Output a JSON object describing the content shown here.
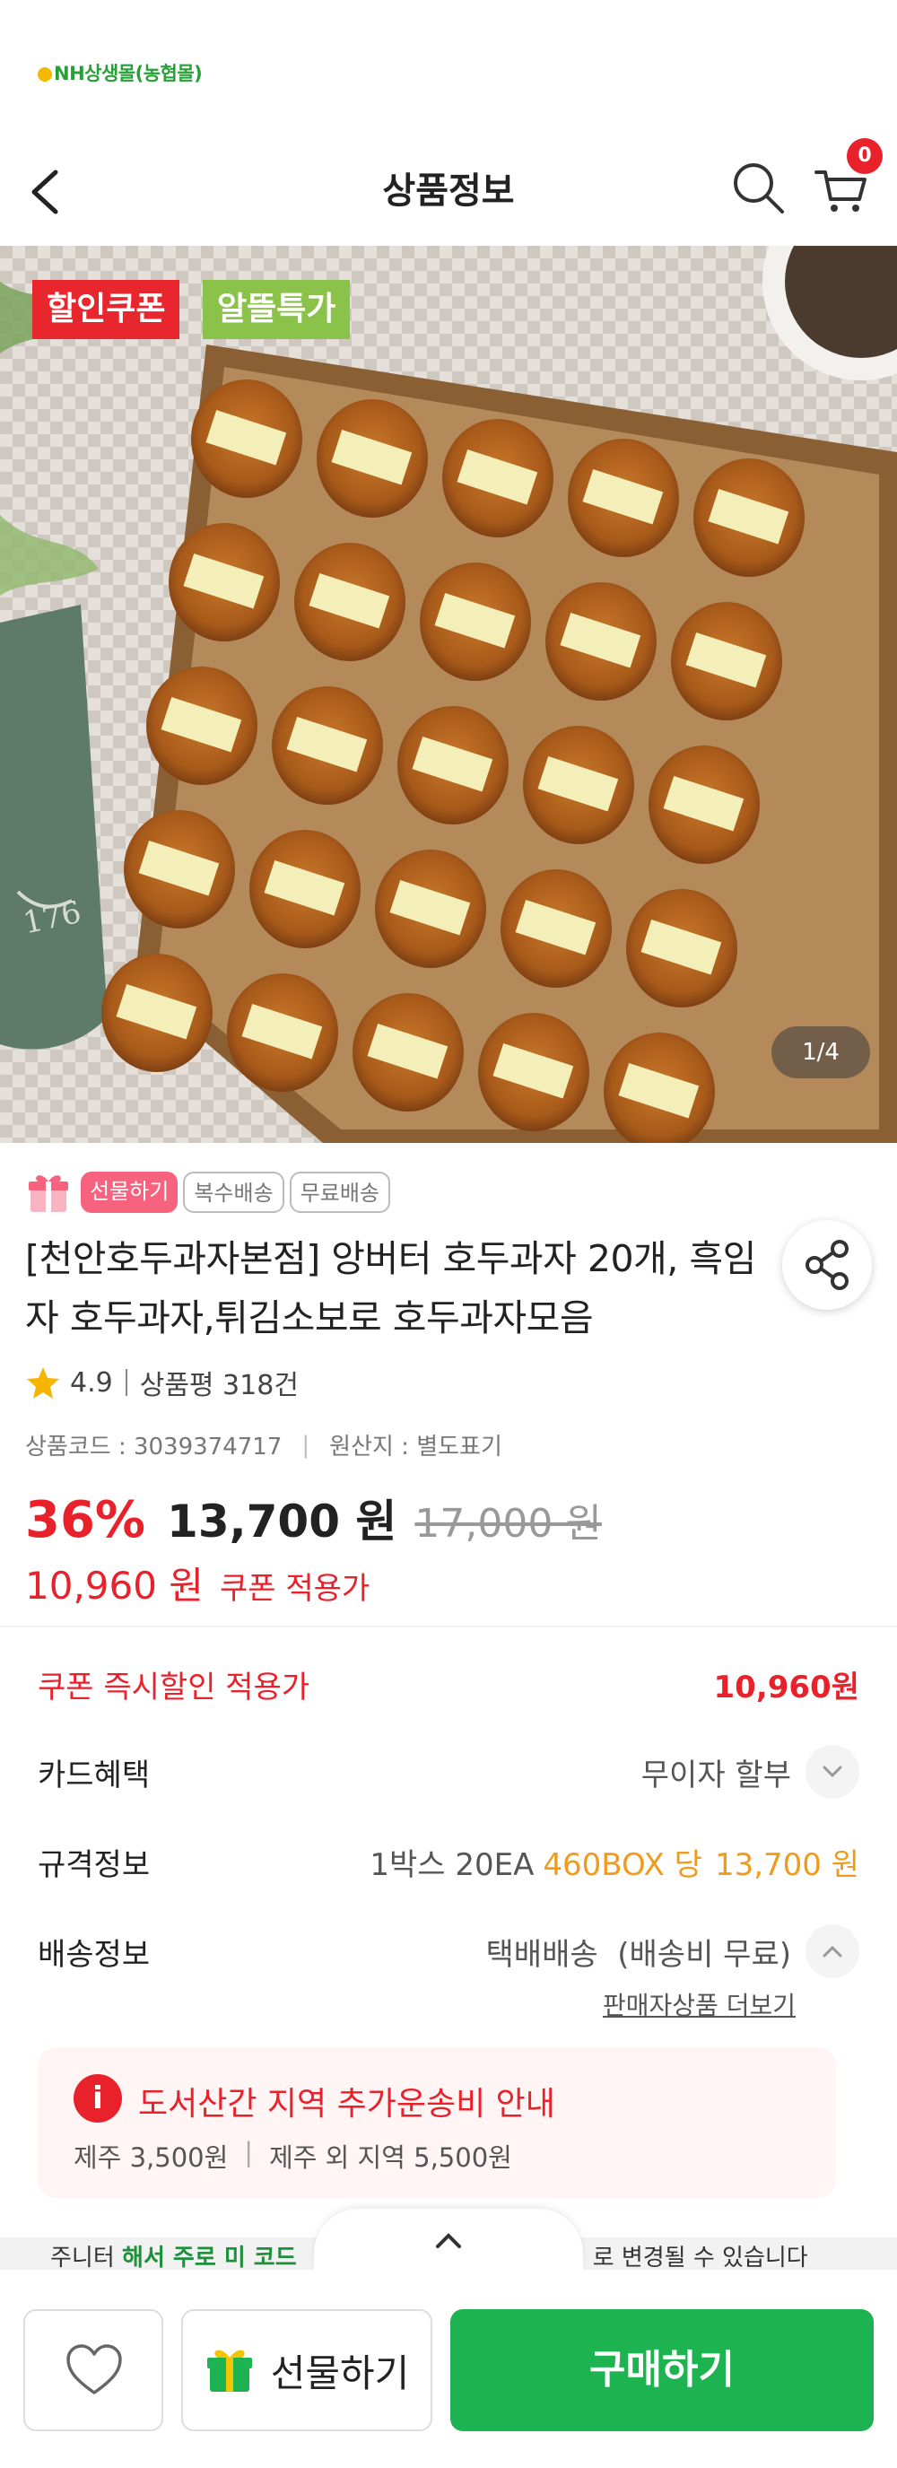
{
  "app": {
    "brand": "NH상생몰(농협몰)"
  },
  "header": {
    "title": "상품정보",
    "cart_count": "0"
  },
  "hero": {
    "tags": [
      "할인쿠폰",
      "알뜰특가"
    ],
    "image_counter": "1/4",
    "box_label": "176"
  },
  "product": {
    "chips": [
      "선물하기",
      "복수배송",
      "무료배송"
    ],
    "title": "[천안호두과자본점] 앙버터 호두과자 20개, 흑임자 호두과자,튀김소보로 호두과자모음",
    "rating": "4.9",
    "review_label": "상품평 318건",
    "code_label": "상품코드 : 3039374717",
    "origin_label": "원산지 : 별도표기",
    "discount_rate": "36%",
    "price": "13,700 원",
    "original_price": "17,000 원",
    "coupon_price": "10,960 원",
    "coupon_label": "쿠폰 적용가"
  },
  "details": {
    "coupon_row": {
      "label": "쿠폰 즉시할인 적용가",
      "value": "10,960원"
    },
    "card_row": {
      "label": "카드혜택",
      "value": "무이자 할부"
    },
    "spec_row": {
      "label": "규격정보",
      "value_prefix": "1박스 20EA",
      "value_unit": "460BOX 당",
      "value_price": "13,700 원"
    },
    "shipping_row": {
      "label": "배송정보",
      "value": "택배배송  (배송비 무료)"
    },
    "seller_link": "판매자상품 더보기"
  },
  "notice": {
    "title": "도서산간 지역 추가운송비 안내",
    "jeju": "제주 3,500원",
    "other": "제주 외 지역 5,500원"
  },
  "peek": {
    "left": "주니터 ",
    "green": "해서 주로 미 코드",
    "right": "로 변경될 수 있습니다"
  },
  "bottom": {
    "gift_label": "선물하기",
    "buy_label": "구매하기"
  },
  "colors": {
    "accent_red": "#e8212b",
    "brand_green": "#1db350",
    "highlight_orange": "#ef9b1e"
  }
}
